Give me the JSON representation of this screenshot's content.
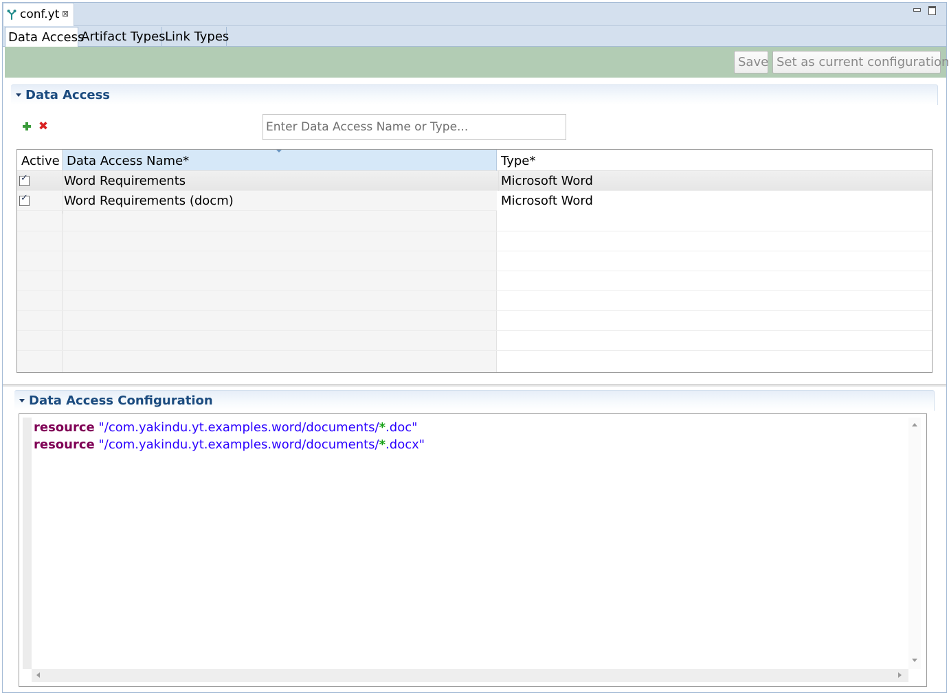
{
  "editor": {
    "tab_title": "conf.yt",
    "close_glyph": "⊠"
  },
  "page_tabs": [
    "Data Access",
    "Artifact Types",
    "Link Types"
  ],
  "toolbar": {
    "save_label": "Save",
    "set_config_label": "Set as current configuration",
    "background_color": "#b2ccb4"
  },
  "data_access_section": {
    "title": "Data Access",
    "filter_placeholder": "Enter Data Access Name or Type...",
    "add_icon": "add-icon",
    "remove_icon": "remove-icon",
    "columns": [
      "Active",
      "Data Access Name*",
      "Type*"
    ],
    "rows": [
      {
        "active": true,
        "name": "Word Requirements",
        "type": "Microsoft Word"
      },
      {
        "active": true,
        "name": "Word Requirements (docm)",
        "type": "Microsoft Word"
      }
    ]
  },
  "config_section": {
    "title": "Data Access Configuration",
    "lines": [
      {
        "keyword": "resource",
        "path_prefix": "\"/com.yakindu.yt.examples.word/documents/",
        "wildcard": "*",
        "path_suffix": ".doc\""
      },
      {
        "keyword": "resource",
        "path_prefix": "\"/com.yakindu.yt.examples.word/documents/",
        "wildcard": "*",
        "path_suffix": ".docx\""
      }
    ]
  },
  "colors": {
    "section_title": "#1b4b7f",
    "keyword": "#7f0055",
    "string": "#2a00ff",
    "wildcard": "#15a015",
    "remove_icon": "#d92020",
    "add_icon": "#3a9b3a"
  }
}
